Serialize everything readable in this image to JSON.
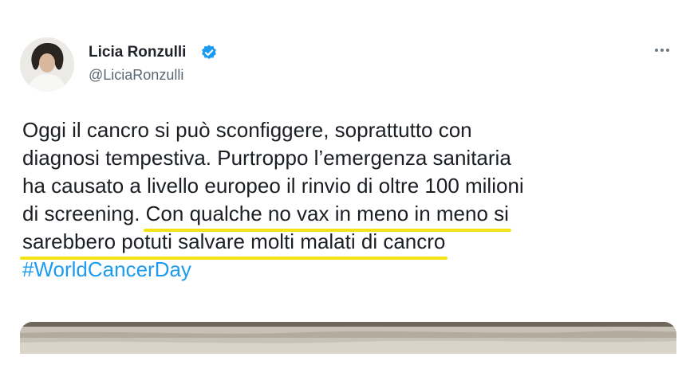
{
  "author": {
    "name": "Licia Ronzulli",
    "handle": "@LiciaRonzulli",
    "verified": true,
    "verified_color": "#1d9bf0"
  },
  "more_icon": "more-horizontal-icon",
  "text": {
    "line1": "Oggi il cancro si può sconfiggere, soprattutto con",
    "line2": "diagnosi tempestiva. Purtroppo l’emergenza sanitaria",
    "line3": "ha causato a livello europeo il rinvio di oltre 100 milioni",
    "line4_plain": "di screening.",
    "line4_highlight": "Con qualche no vax in meno in meno si",
    "line5_highlight": "sarebbero potuti salvare molti malati di cancro",
    "hashtag": "#WorldCancerDay"
  },
  "colors": {
    "highlight_underline": "#f5e316",
    "hashtag": "#1d9bf0",
    "text": "#1b1f23",
    "handle": "#5b6873"
  }
}
